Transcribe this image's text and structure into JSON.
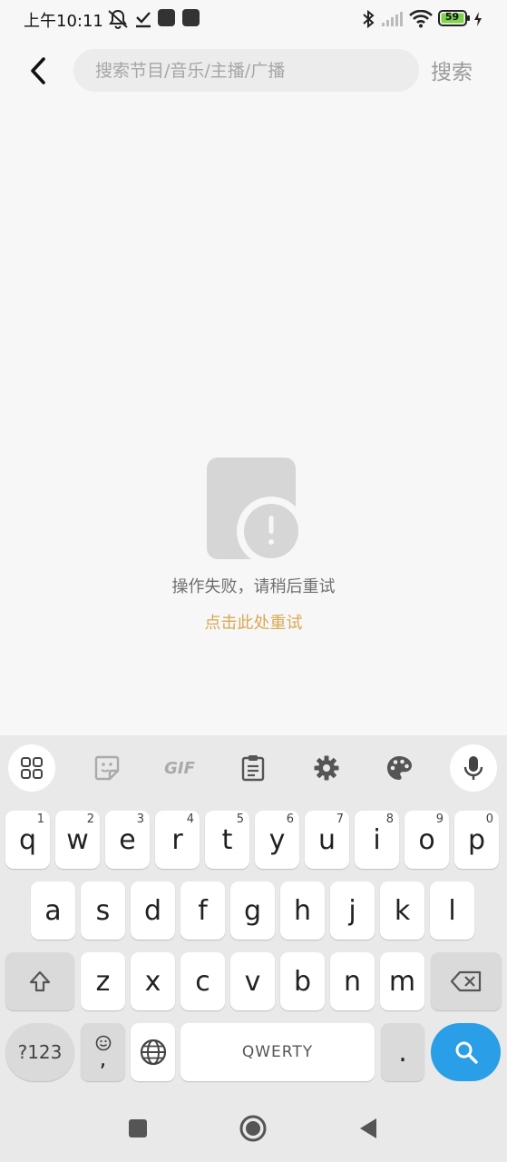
{
  "status_bar": {
    "time": "上午10:11",
    "battery": "59"
  },
  "header": {
    "search_placeholder": "搜索节目/音乐/主播/广播",
    "search_value": "",
    "search_button": "搜索"
  },
  "error_state": {
    "message": "操作失败，请稍后重试",
    "retry": "点击此处重试"
  },
  "keyboard": {
    "toolbar": [
      "apps-grid-icon",
      "sticker-icon",
      "gif-icon",
      "clipboard-icon",
      "gear-icon",
      "palette-icon",
      "mic-icon"
    ],
    "gif_label": "GIF",
    "row1": [
      {
        "k": "q",
        "h": "1"
      },
      {
        "k": "w",
        "h": "2"
      },
      {
        "k": "e",
        "h": "3"
      },
      {
        "k": "r",
        "h": "4"
      },
      {
        "k": "t",
        "h": "5"
      },
      {
        "k": "y",
        "h": "6"
      },
      {
        "k": "u",
        "h": "7"
      },
      {
        "k": "i",
        "h": "8"
      },
      {
        "k": "o",
        "h": "9"
      },
      {
        "k": "p",
        "h": "0"
      }
    ],
    "row2": [
      "a",
      "s",
      "d",
      "f",
      "g",
      "h",
      "j",
      "k",
      "l"
    ],
    "row3": [
      "z",
      "x",
      "c",
      "v",
      "b",
      "n",
      "m"
    ],
    "symbols_key": "?123",
    "comma_key": ",",
    "space_label": "QWERTY",
    "period_key": "."
  },
  "colors": {
    "retry": "#d9a955",
    "search_key": "#2a9ee6",
    "battery": "#7dd34b"
  }
}
